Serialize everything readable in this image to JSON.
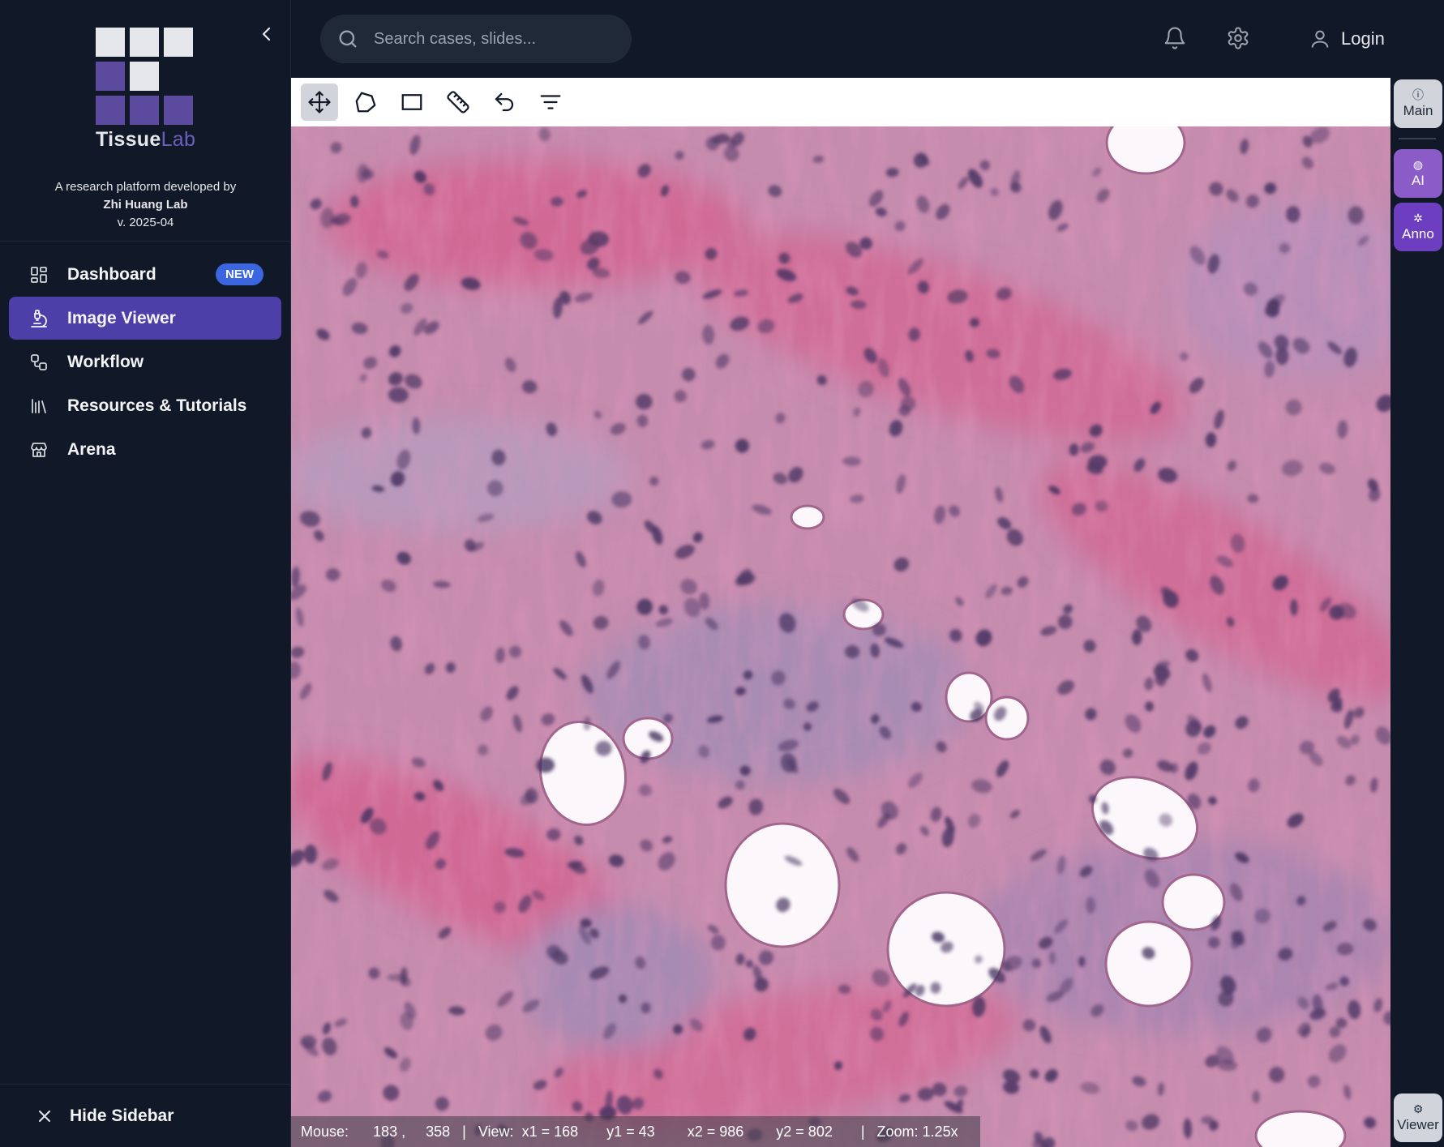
{
  "app": {
    "logo_text_main": "Tissue",
    "logo_text_accent": "Lab",
    "tagline_line1": "A research platform developed by",
    "tagline_lab": "Zhi Huang Lab",
    "version": "v. 2025-04"
  },
  "sidebar": {
    "items": [
      {
        "label": "Dashboard",
        "icon": "dashboard-icon",
        "badge": "NEW",
        "active": false
      },
      {
        "label": "Image Viewer",
        "icon": "microscope-icon",
        "active": true
      },
      {
        "label": "Workflow",
        "icon": "workflow-icon",
        "active": false
      },
      {
        "label": "Resources & Tutorials",
        "icon": "library-icon",
        "active": false
      },
      {
        "label": "Arena",
        "icon": "store-icon",
        "active": false
      }
    ],
    "hide_label": "Hide Sidebar"
  },
  "topbar": {
    "search_placeholder": "Search cases, slides...",
    "login_label": "Login"
  },
  "toolbar": {
    "tools": [
      "move-tool-icon",
      "polygon-tool-icon",
      "rectangle-tool-icon",
      "ruler-tool-icon",
      "undo-icon",
      "filter-icon"
    ]
  },
  "status": {
    "mouse_label": "Mouse:",
    "mouse_x": "183",
    "mouse_y": "358",
    "view_label": "View:",
    "x1": "x1 = 168",
    "y1": "y1 = 43",
    "x2": "x2 = 986",
    "y2": "y2 = 802",
    "zoom": "Zoom: 1.25x"
  },
  "rail": {
    "main": "Main",
    "ai": "AI",
    "anno": "Anno",
    "viewer": "Viewer"
  },
  "colors": {
    "sidebar_bg": "#111827",
    "active_nav": "#4c3fa8",
    "badge": "#3b66e0",
    "ai_button": "#8b5cc8",
    "anno_button": "#6d3fc0",
    "tissue_pink": "#c98aa9",
    "nucleus": "#4a3566"
  }
}
